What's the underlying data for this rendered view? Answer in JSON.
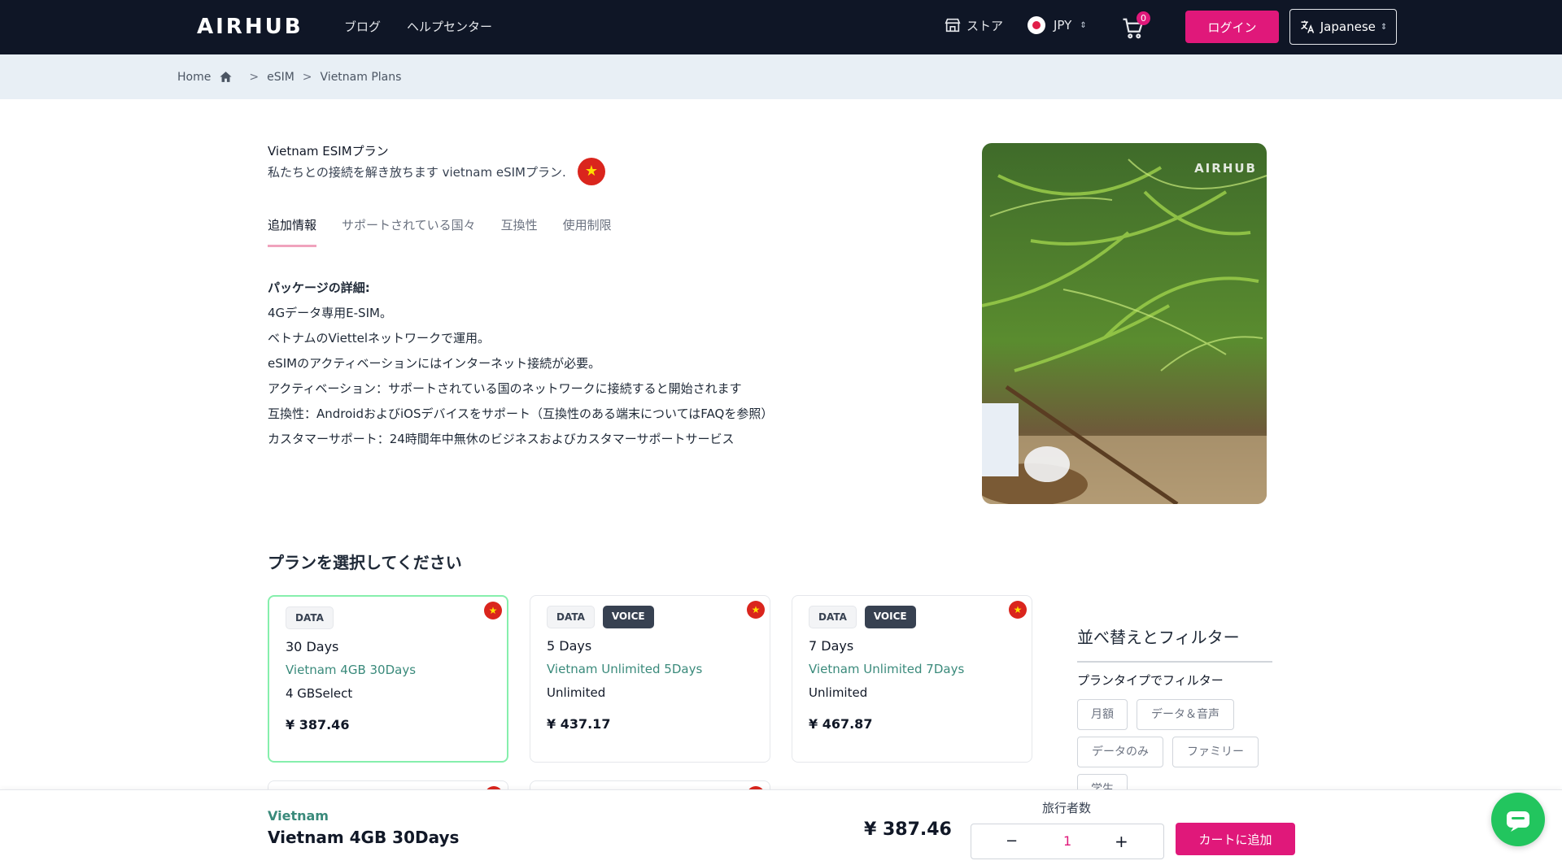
{
  "header": {
    "logo": "AIRHUB",
    "nav": [
      "ブログ",
      "ヘルプセンター"
    ],
    "store_label": "ストア",
    "currency": "JPY",
    "cart_count": "0",
    "login_label": "ログイン",
    "language": "Japanese"
  },
  "breadcrumb": [
    "Home",
    "eSIM",
    "Vietnam Plans"
  ],
  "product": {
    "title": "Vietnam ESIMプラン",
    "subtitle": "私たちとの接続を解き放ちます vietnam eSIMプラン.",
    "image_watermark": "AIRHUB"
  },
  "tabs": [
    "追加情報",
    "サポートされている国々",
    "互換性",
    "使用制限"
  ],
  "active_tab": 0,
  "details": {
    "heading": "パッケージの詳細:",
    "lines": [
      "4Gデータ専用E-SIM。",
      "ベトナムのViettelネットワークで運用。",
      "eSIMのアクティベーションにはインターネット接続が必要。",
      "アクティベーション：サポートされている国のネットワークに接続すると開始されます",
      "互換性：AndroidおよびiOSデバイスをサポート（互換性のある端末についてはFAQを参照）",
      "カスタマーサポート：24時間年中無休のビジネスおよびカスタマーサポートサービス"
    ]
  },
  "plans_section_title": "プランを選択してください",
  "plans": [
    {
      "tags": [
        "DATA"
      ],
      "days": "30 Days",
      "name": "Vietnam 4GB 30Days",
      "amount": "4 GBSelect",
      "price": "¥ 387.46",
      "selected": true
    },
    {
      "tags": [
        "DATA",
        "VOICE"
      ],
      "days": "5 Days",
      "name": "Vietnam Unlimited 5Days",
      "amount": "Unlimited",
      "price": "¥ 437.17",
      "selected": false
    },
    {
      "tags": [
        "DATA",
        "VOICE"
      ],
      "days": "7 Days",
      "name": "Vietnam Unlimited 7Days",
      "amount": "Unlimited",
      "price": "¥ 467.87",
      "selected": false
    }
  ],
  "filter": {
    "title": "並べ替えとフィルター",
    "subtitle": "プランタイプでフィルター",
    "chips": [
      "月額",
      "データ＆音声",
      "データのみ",
      "ファミリー",
      "学生"
    ]
  },
  "bottom_bar": {
    "country": "Vietnam",
    "plan": "Vietnam 4GB 30Days",
    "price": "¥ 387.46",
    "travelers_label": "旅行者数",
    "quantity": "1",
    "minus": "−",
    "plus": "+",
    "add_to_cart": "カートに追加"
  },
  "colors": {
    "header_bg": "#0f1626",
    "accent": "#e0187a",
    "plan_name": "#3a8a7b",
    "breadcrumb_bg": "#e8eff5",
    "selected_border": "#86efac"
  }
}
